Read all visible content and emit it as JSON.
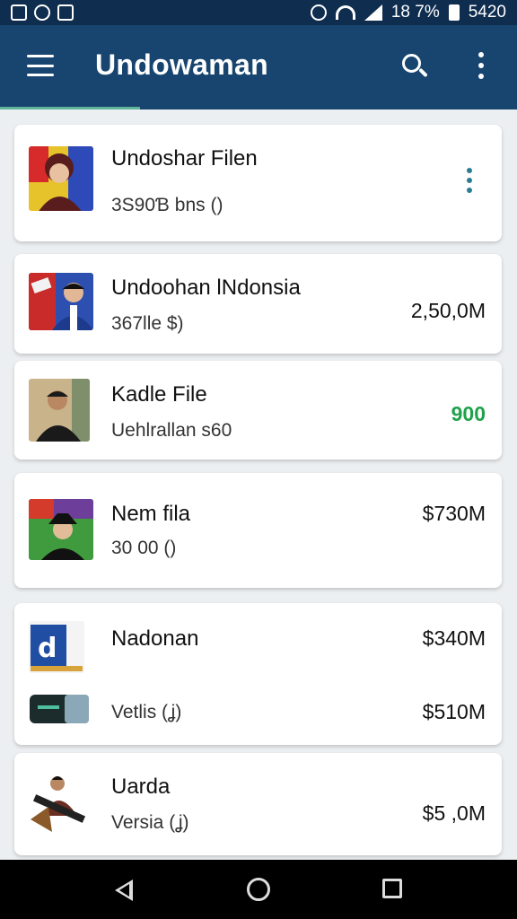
{
  "status_bar": {
    "left_icons": [
      "notification-icon",
      "sync-icon",
      "image-icon"
    ],
    "right_icons": [
      "vibrate-icon",
      "wifi-icon",
      "signal-icon"
    ],
    "battery_text": "18 7%",
    "time": "5420"
  },
  "app_bar": {
    "title": "Undowaman",
    "icons": [
      "menu-icon",
      "search-icon",
      "more-vert-icon"
    ]
  },
  "list": [
    {
      "title": "Undoshar Filen",
      "subtitle": "3S90Ɓ bns ()",
      "amount": "",
      "has_menu": true
    },
    {
      "title": "Undoohan lNdonsia",
      "subtitle": "367lle $)",
      "amount": "2,50,0M"
    },
    {
      "title": "Kadle File",
      "subtitle": "Uehlrallan s60",
      "amount": "900"
    },
    {
      "title": "Nem fila",
      "subtitle": "30 00 ()",
      "amount": "$730M"
    },
    {
      "title": "Nadonan",
      "subtitle": "Vetlis (ʝ)",
      "amount": "$340M",
      "amount_2": "$510M"
    },
    {
      "title": "Uarda",
      "subtitle": "Versia (ʝ)",
      "amount": "$5 ,0M"
    }
  ],
  "colors": {
    "status_bar": "#0f2d4f",
    "app_bar": "#17456f",
    "accent_green": "#1ea34b",
    "indicator": "#5fb49a"
  },
  "nav_bar": {
    "icons": [
      "back-icon",
      "home-icon",
      "recents-icon"
    ]
  }
}
